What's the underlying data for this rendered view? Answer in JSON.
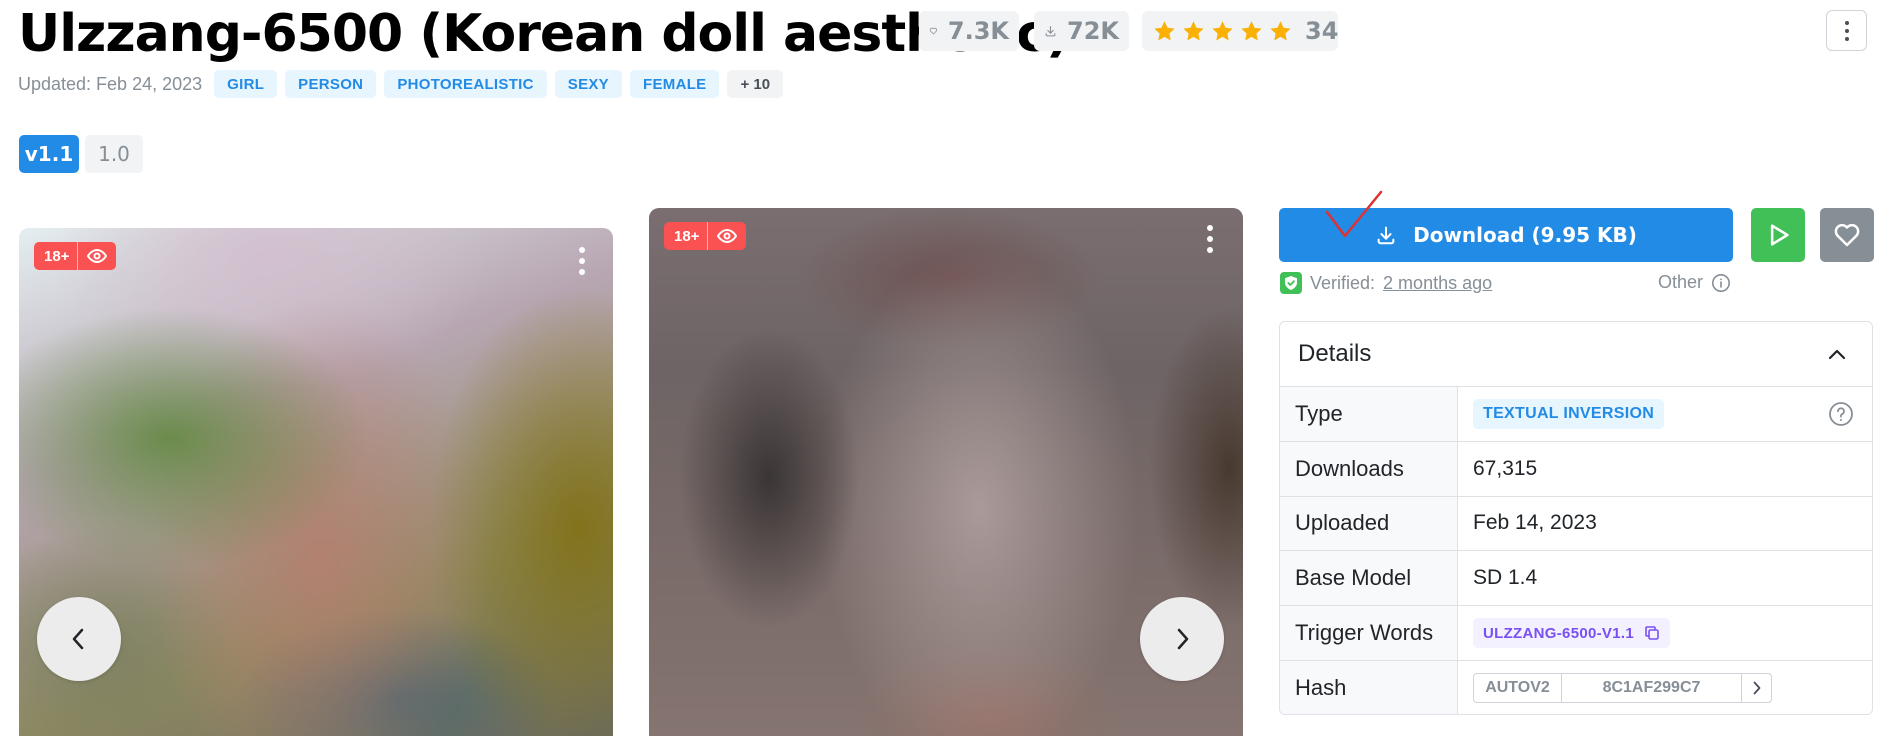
{
  "header": {
    "title": "Ulzzang-6500 (Korean doll aesthetic)",
    "likes": "7.3K",
    "downloads": "72K",
    "rating_stars": 5,
    "rating_count": "34",
    "updated": "Updated: Feb 24, 2023",
    "tags": [
      "GIRL",
      "PERSON",
      "PHOTOREALISTIC",
      "SEXY",
      "FEMALE"
    ],
    "more_tags": "+ 10"
  },
  "versions": {
    "active": "v1.1",
    "other": "1.0"
  },
  "gallery": {
    "nsfw_badge": "18+",
    "icons": [
      "eye-icon",
      "more-vertical-icon",
      "chevron-left-icon",
      "chevron-right-icon"
    ]
  },
  "actions": {
    "download_label": "Download (9.95 KB)",
    "verified_label": "Verified:",
    "verified_date": "2 months ago",
    "other_label": "Other"
  },
  "details": {
    "title": "Details",
    "rows": {
      "type": {
        "label": "Type",
        "value": "TEXTUAL INVERSION"
      },
      "downloads": {
        "label": "Downloads",
        "value": "67,315"
      },
      "uploaded": {
        "label": "Uploaded",
        "value": "Feb 14, 2023"
      },
      "base_model": {
        "label": "Base Model",
        "value": "SD 1.4"
      },
      "trigger_words": {
        "label": "Trigger Words",
        "value": "ULZZANG-6500-V1.1"
      },
      "hash": {
        "label": "Hash",
        "type": "AUTOV2",
        "value": "8C1AF299C7"
      }
    }
  },
  "colors": {
    "primary": "#228be6",
    "success": "#40c057",
    "danger": "#fa5252",
    "star": "#fab005",
    "muted": "#868e96",
    "annotation": "#e03131"
  }
}
